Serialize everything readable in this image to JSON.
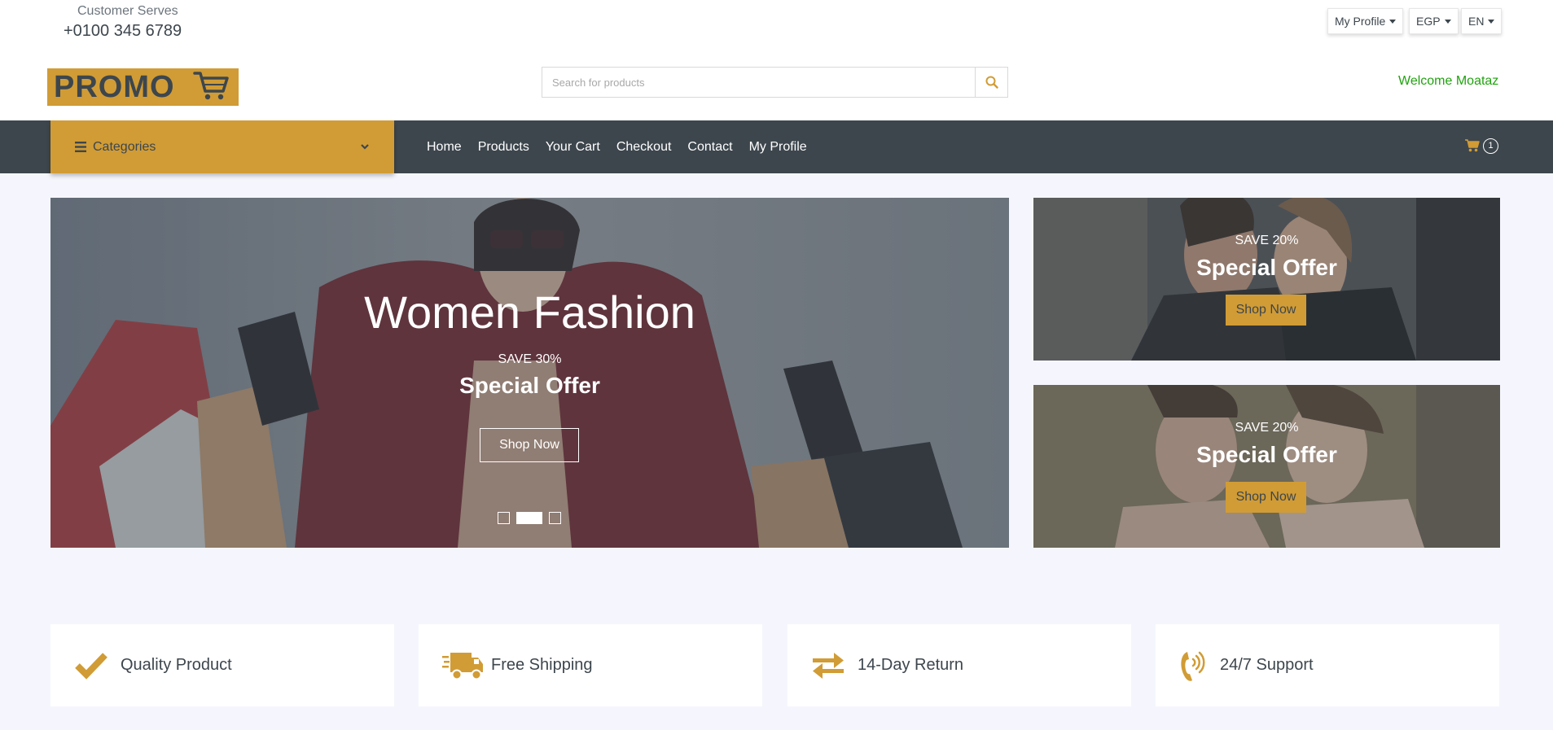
{
  "topbar": {
    "customer_label": "Customer Serves",
    "phone": "+0100 345 6789",
    "dropdowns": [
      "My Profile",
      "EGP",
      "EN"
    ]
  },
  "logo": {
    "text": "PROMO"
  },
  "search": {
    "placeholder": "Search for products"
  },
  "welcome": "Welcome Moataz",
  "navbar": {
    "categories_label": "Categories",
    "links": [
      "Home",
      "Products",
      "Your Cart",
      "Checkout",
      "Contact",
      "My Profile"
    ],
    "cart_count": "1"
  },
  "hero": {
    "title": "Women Fashion",
    "save": "SAVE 30%",
    "special": "Special Offer",
    "button": "Shop Now",
    "slides": 3,
    "active_slide": 2
  },
  "offers": [
    {
      "save": "SAVE 20%",
      "special": "Special Offer",
      "button": "Shop Now"
    },
    {
      "save": "SAVE 20%",
      "special": "Special Offer",
      "button": "Shop Now"
    }
  ],
  "features": [
    {
      "icon": "check-icon",
      "label": "Quality Product"
    },
    {
      "icon": "shipping-truck-icon",
      "label": "Free Shipping"
    },
    {
      "icon": "exchange-arrows-icon",
      "label": "14-Day Return"
    },
    {
      "icon": "phone-volume-icon",
      "label": "24/7 Support"
    }
  ],
  "colors": {
    "accent": "#d19c35",
    "dark": "#3d464d",
    "welcome": "#21a30f",
    "background": "#f5f6fd"
  }
}
